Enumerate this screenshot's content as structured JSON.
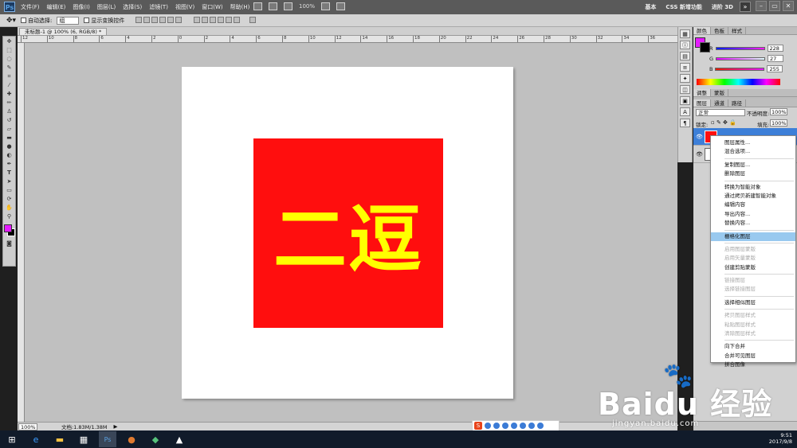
{
  "app": {
    "logo": "Ps"
  },
  "menus": [
    "文件(F)",
    "编辑(E)",
    "图像(I)",
    "图层(L)",
    "选择(S)",
    "滤镜(T)",
    "视图(V)",
    "窗口(W)",
    "帮助(H)"
  ],
  "menubar_tools": {
    "zoom": "100%"
  },
  "workspaces": [
    "基本",
    "CSS 新增功能",
    "进阶 3D"
  ],
  "workspace_more": "»",
  "window_controls": [
    "–",
    "▭",
    "✕"
  ],
  "options": {
    "auto_select_label": "自动选择:",
    "auto_select_value": "组",
    "show_transform_label": "显示变换控件"
  },
  "document": {
    "tab_title": "未标题-1 @ 100% (6, RGB/8) *",
    "artwork_text": "二逗",
    "colors": {
      "square": "#ff0e0e",
      "text": "#ffff00"
    }
  },
  "rulers": {
    "top": [
      "12",
      "10",
      "8",
      "6",
      "4",
      "2",
      "0",
      "2",
      "4",
      "6",
      "8",
      "10",
      "12",
      "14",
      "16",
      "18",
      "20",
      "22",
      "24",
      "26",
      "28",
      "30",
      "32",
      "34",
      "36"
    ]
  },
  "status": {
    "zoom": "100%",
    "doc_label": "文档:1.83M/1.38M"
  },
  "color_panel": {
    "tabs": [
      "颜色",
      "色板",
      "样式"
    ],
    "channels": [
      {
        "label": "R",
        "value": "228",
        "color": "#e41bff"
      },
      {
        "label": "G",
        "value": "27",
        "color": "#e41bff"
      },
      {
        "label": "B",
        "value": "255",
        "color": "#e41bff"
      }
    ],
    "foreground": "#e41bff"
  },
  "adjust_tabs": [
    "调整",
    "蒙版"
  ],
  "layers_panel": {
    "tabs": [
      "图层",
      "通道",
      "路径"
    ],
    "blend_mode": "正常",
    "opacity_label": "不透明度:",
    "opacity_value": "100%",
    "lock_label": "锁定:",
    "fill_label": "填充:",
    "fill_value": "100%"
  },
  "context_menu": {
    "items": [
      {
        "label": "图层属性...",
        "enabled": true
      },
      {
        "label": "混合选项...",
        "enabled": true
      },
      {
        "sep": true
      },
      {
        "label": "复制图层...",
        "enabled": true
      },
      {
        "label": "删除图层",
        "enabled": true
      },
      {
        "sep": true
      },
      {
        "label": "转换为智能对象",
        "enabled": true
      },
      {
        "label": "通过拷贝新建智能对象",
        "enabled": true
      },
      {
        "label": "编辑内容",
        "enabled": true
      },
      {
        "label": "导出内容...",
        "enabled": true
      },
      {
        "label": "替换内容...",
        "enabled": true
      },
      {
        "sep": true
      },
      {
        "label": "栅格化图层",
        "enabled": true,
        "highlight": true
      },
      {
        "sep": true
      },
      {
        "label": "启用图层蒙版",
        "enabled": false
      },
      {
        "label": "启用矢量蒙版",
        "enabled": false
      },
      {
        "label": "创建剪贴蒙版",
        "enabled": true
      },
      {
        "sep": true
      },
      {
        "label": "链接图层",
        "enabled": false
      },
      {
        "label": "选择链接图层",
        "enabled": false
      },
      {
        "sep": true
      },
      {
        "label": "选择相似图层",
        "enabled": true
      },
      {
        "sep": true
      },
      {
        "label": "拷贝图层样式",
        "enabled": false
      },
      {
        "label": "粘贴图层样式",
        "enabled": false
      },
      {
        "label": "清除图层样式",
        "enabled": false
      },
      {
        "sep": true
      },
      {
        "label": "向下合并",
        "enabled": true
      },
      {
        "label": "合并可见图层",
        "enabled": true
      },
      {
        "label": "拼合图像",
        "enabled": true
      }
    ]
  },
  "taskbar": {
    "time": "9:51",
    "date": "2017/9/8"
  },
  "watermark": {
    "brand": "Baidu 经验",
    "url": "jingyan.baidu.com"
  }
}
